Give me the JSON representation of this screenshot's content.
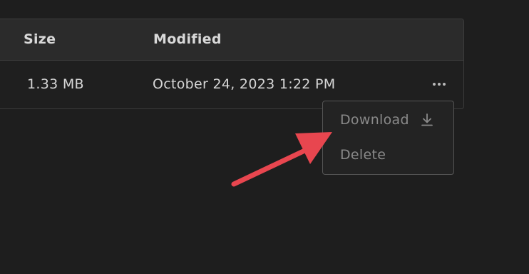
{
  "table": {
    "columns": {
      "size": "Size",
      "modified": "Modified"
    },
    "rows": [
      {
        "size": "1.33 MB",
        "modified": "October 24, 2023 1:22 PM"
      }
    ]
  },
  "context_menu": {
    "items": [
      {
        "label": "Download",
        "icon": "download-icon"
      },
      {
        "label": "Delete"
      }
    ]
  },
  "annotation": {
    "arrow_color": "#e8464f"
  },
  "colors": {
    "background": "#1e1e1e",
    "header_background": "#2b2b2b",
    "border": "#3c3c3c",
    "menu_text_disabled": "#8a8a8a"
  }
}
